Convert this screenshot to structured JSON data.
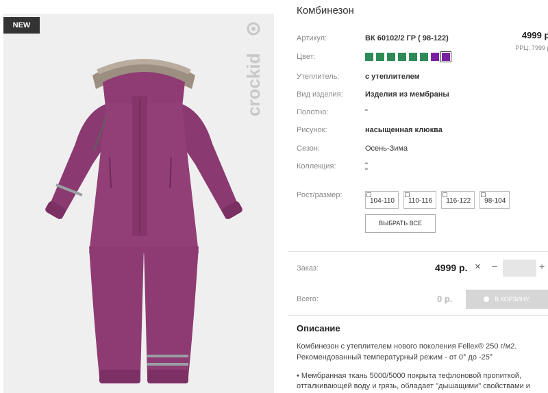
{
  "badge": "NEW",
  "brand": "crockid",
  "product": {
    "title": "Комбинезон"
  },
  "attributes": [
    {
      "label": "Артикул:",
      "value": "ВК 60102/2 ГР ( 98-122)"
    },
    {
      "label": "Цвет:"
    },
    {
      "label": "Утеплитель:",
      "value": "с утеплителем"
    },
    {
      "label": "Вид изделия:",
      "value": "Изделия из мембраны"
    },
    {
      "label": "Полотно:",
      "value": "\""
    },
    {
      "label": "Рисунок:",
      "value": "насыщенная клюква"
    },
    {
      "label": "Сезон:",
      "value": "Осень-Зима"
    },
    {
      "label": "Коллекция:",
      "value": "\"",
      "value2": "\""
    },
    {
      "label": "Рост/размер:"
    }
  ],
  "price": {
    "main": "4999 р.",
    "rrp": "РРЦ: 7999 р."
  },
  "colors": [
    "#2e8b57",
    "#2e8b57",
    "#2e8b57",
    "#2e8b57",
    "#2e8b57",
    "#2e8b57",
    "#7b1fa2",
    "#7b1fa2"
  ],
  "sizes": [
    "104-110",
    "110-116",
    "116-122",
    "98-104"
  ],
  "select_all": "ВЫБРАТЬ ВСЕ",
  "order": {
    "label": "Заказ:",
    "price": "4999 р.",
    "remove_icon": "×",
    "minus": "–",
    "plus": "+",
    "qty": ""
  },
  "total": {
    "label": "Всего:",
    "value": "0 р.",
    "cart_button": "В КОРЗИНУ"
  },
  "description": {
    "title": "Описание",
    "line1": "Комбинезон с утеплителем нового поколения Fellex® 250 г/м2.",
    "line2": "Рекомендованный температурный режим - от 0° до -25°",
    "line3": "• Мембранная ткань 5000/5000 покрыта тефлоновой пропиткой,",
    "line4": "отталкивающей воду и грязь, обладает \"дышащими\" свойствами и"
  }
}
